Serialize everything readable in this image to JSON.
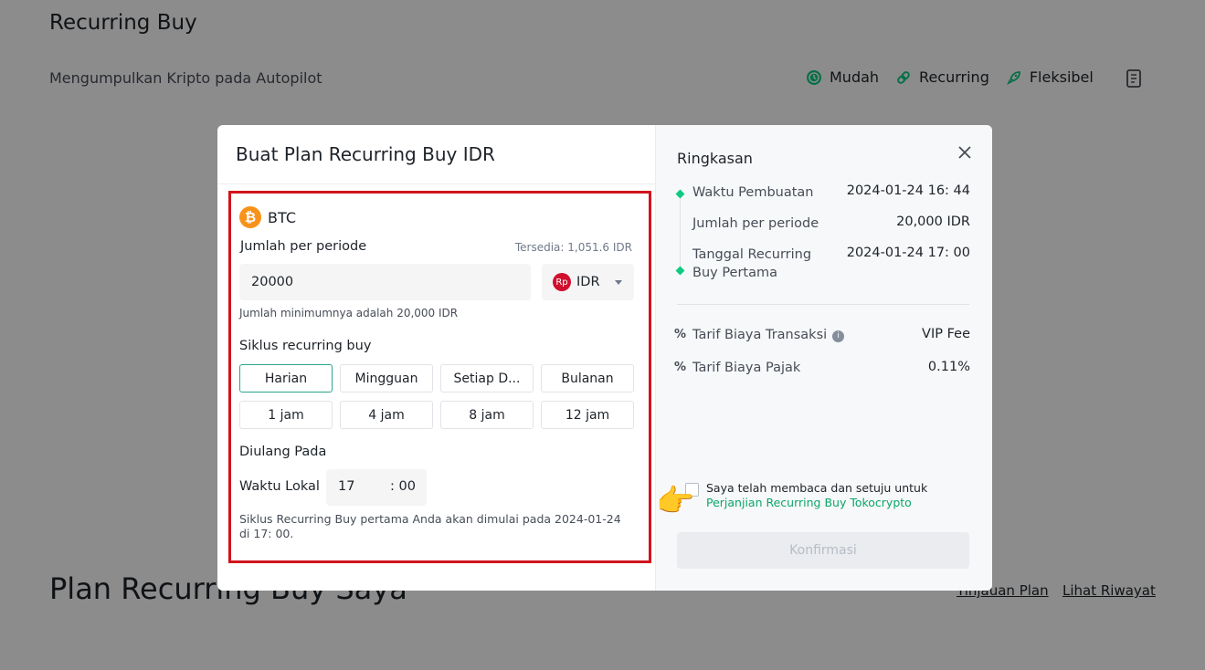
{
  "background": {
    "title": "Recurring Buy",
    "subtitle": "Mengumpulkan Kripto pada Autopilot",
    "features": [
      {
        "label": "Mudah",
        "icon": "clock-dollar-icon"
      },
      {
        "label": "Recurring",
        "icon": "link-icon"
      },
      {
        "label": "Fleksibel",
        "icon": "rocket-icon"
      }
    ],
    "plan_title": "Plan Recurring Buy Saya",
    "links": [
      "Tinjauan Plan",
      "Lihat Riwayat"
    ]
  },
  "modal": {
    "title": "Buat Plan Recurring Buy IDR",
    "coin": {
      "symbol_glyph": "₿",
      "name": "BTC",
      "color": "#f7931a"
    },
    "amount": {
      "label": "Jumlah per periode",
      "available": "Tersedia: 1,051.6 IDR",
      "value": "20000",
      "currency_icon": "Rp",
      "currency": "IDR",
      "min_note": "Jumlah minimumnya adalah 20,000 IDR"
    },
    "cycle": {
      "label": "Siklus recurring buy",
      "options": [
        "Harian",
        "Mingguan",
        "Setiap D...",
        "Bulanan"
      ],
      "selected": "Harian",
      "hours": [
        "1 jam",
        "4 jam",
        "8 jam",
        "12 jam"
      ]
    },
    "repeat": {
      "label": "Diulang Pada",
      "local_label": "Waktu Lokal",
      "hour": "17",
      "minute": ": 00",
      "note": "Siklus Recurring Buy pertama Anda akan dimulai pada 2024-01-24 di 17: 00."
    },
    "summary": {
      "title": "Ringkasan",
      "created_label": "Waktu Pembuatan",
      "created_value": "2024-01-24 16: 44",
      "amount_label": "Jumlah per periode",
      "amount_value": "20,000 IDR",
      "first_label": "Tanggal Recurring Buy Pertama",
      "first_value": "2024-01-24 17: 00",
      "fee_label": "Tarif Biaya Transaksi",
      "fee_value": "VIP Fee",
      "tax_label": "Tarif Biaya Pajak",
      "tax_value": "0.11%"
    },
    "agreement": {
      "text": "Saya telah membaca dan setuju untuk",
      "link": "Perjanjian Recurring Buy Tokocrypto",
      "hand": "👉"
    },
    "confirm_label": "Konfirmasi",
    "close_glyph": "✕"
  },
  "colors": {
    "accent": "#0ecb81",
    "highlight_border": "#d0141c",
    "link": "#0ca66b"
  }
}
